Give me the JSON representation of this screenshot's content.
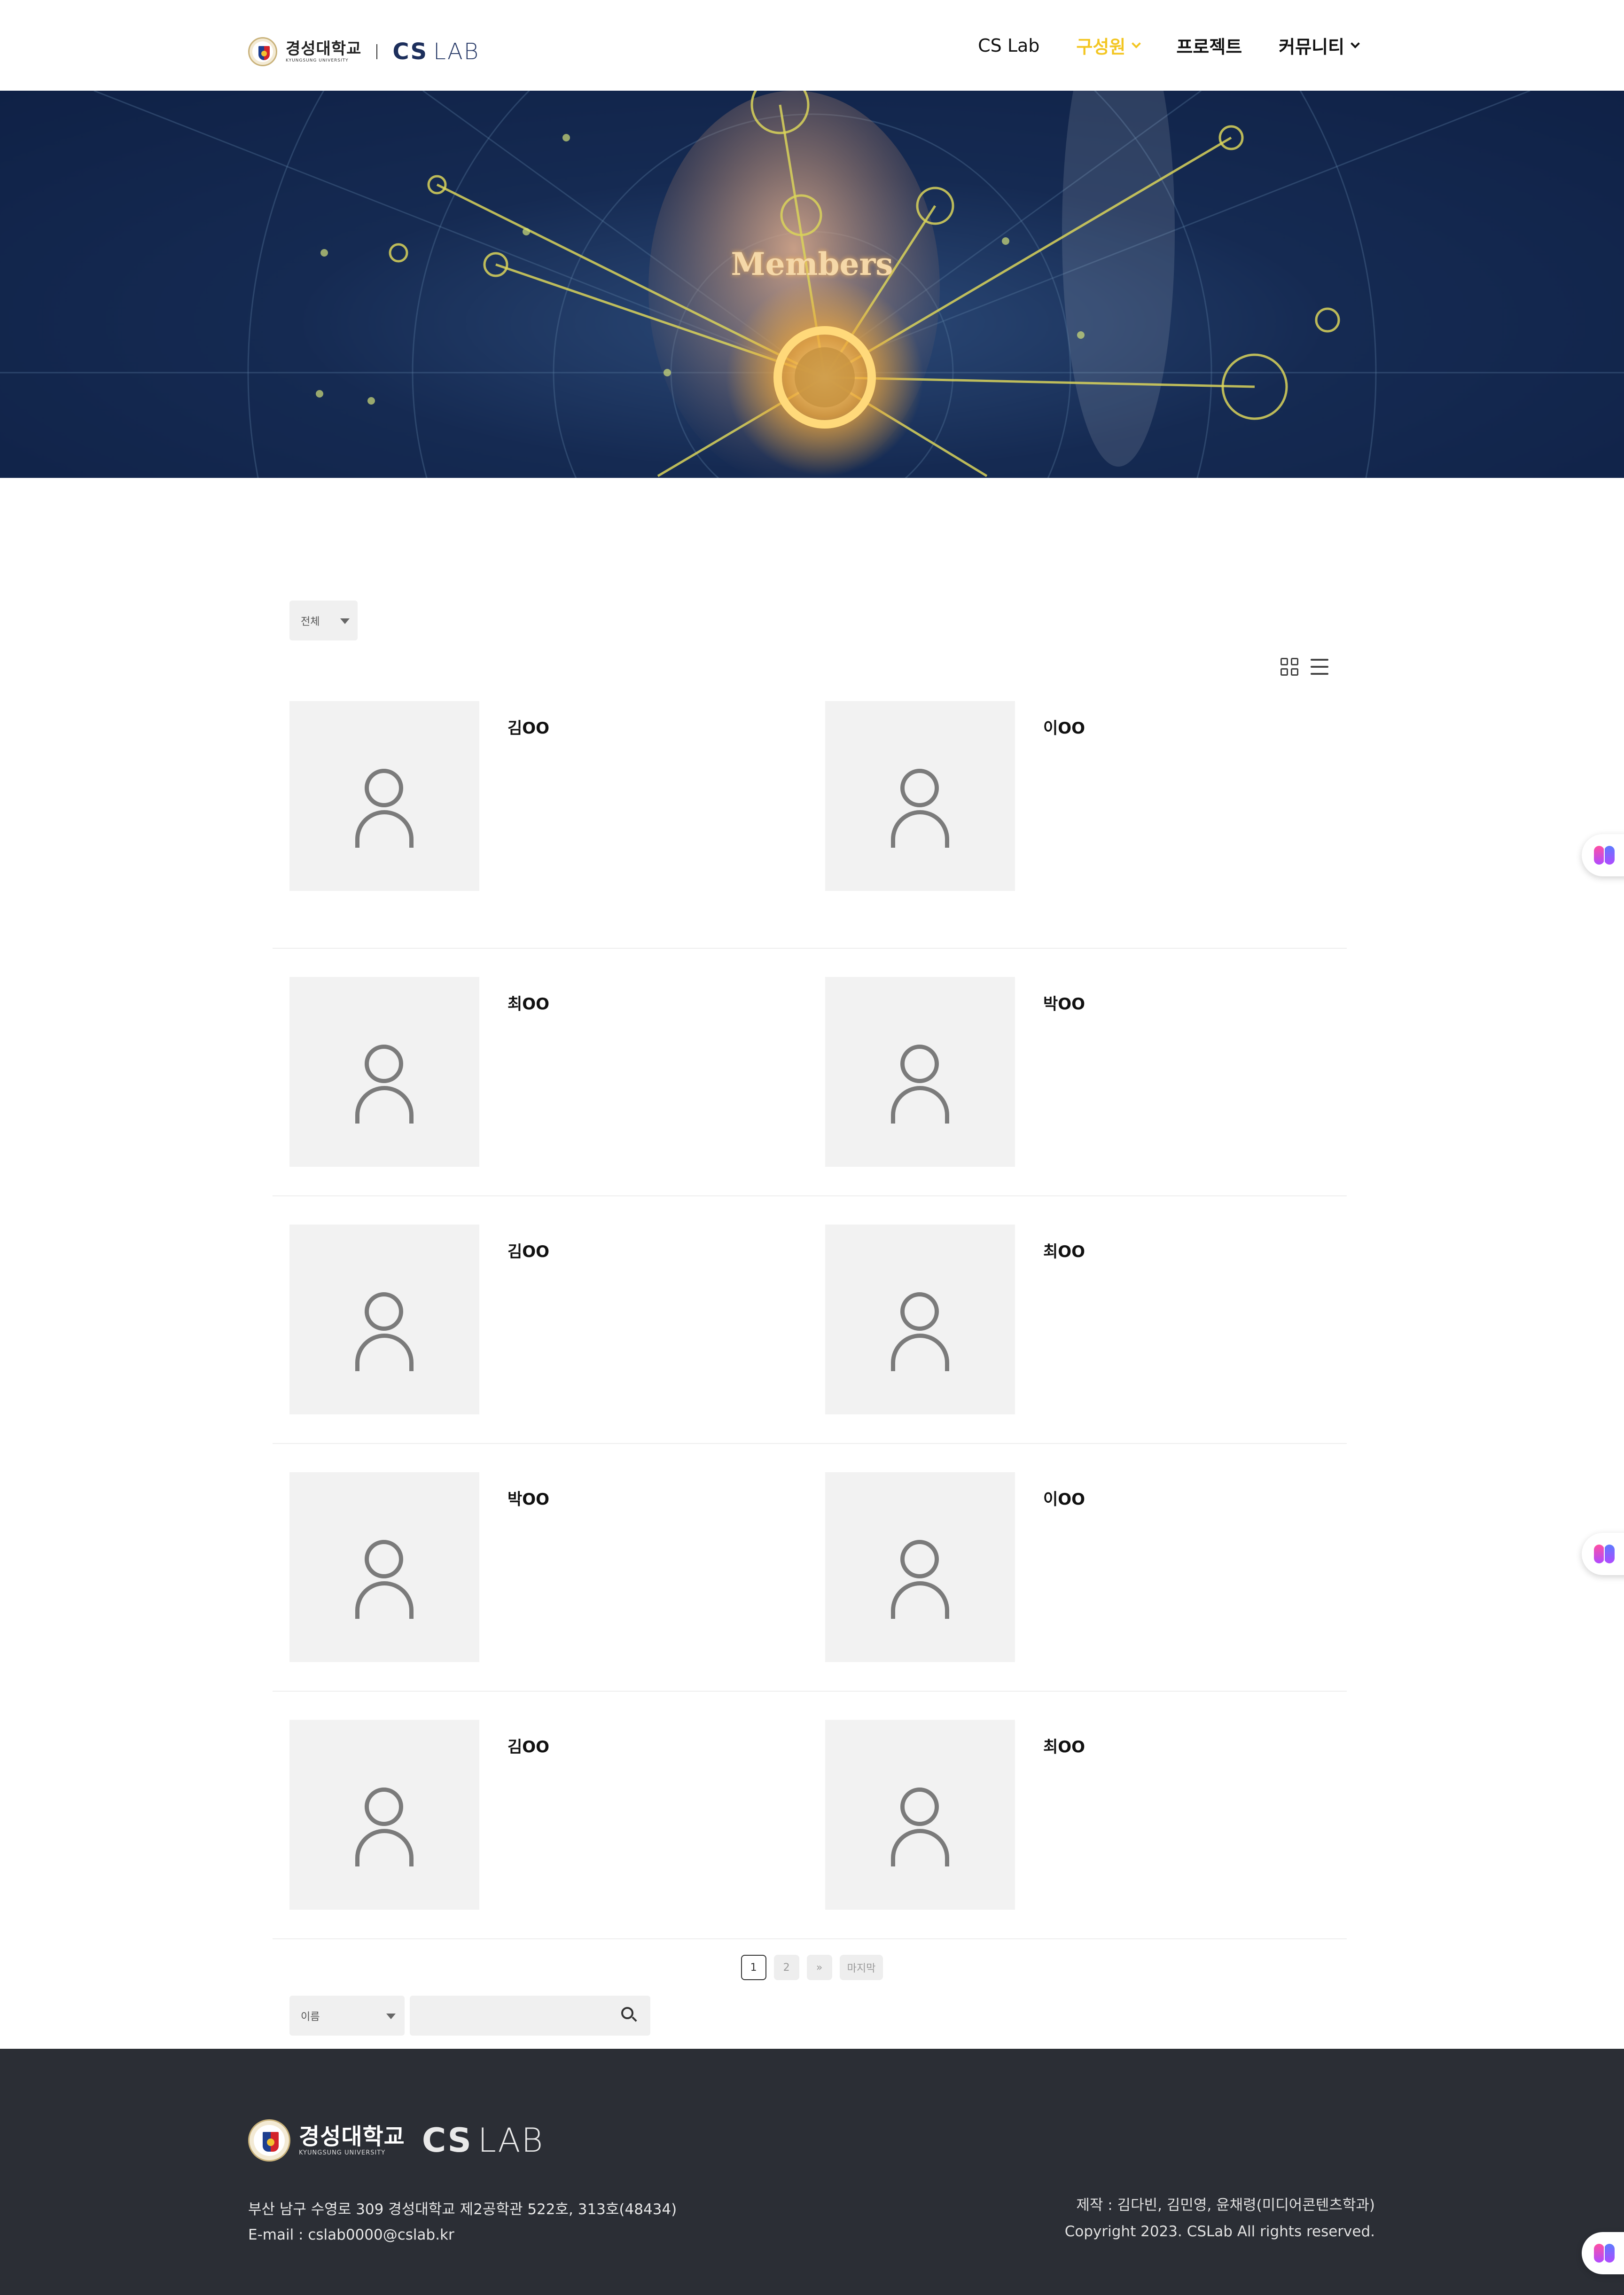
{
  "header": {
    "logo": {
      "university_ko": "경성대학교",
      "university_en": "KYUNGSUNG UNIVERSITY",
      "lab_cs": "CS",
      "lab_lab": "LAB"
    },
    "nav": [
      {
        "label": "CS Lab"
      },
      {
        "label": "구성원"
      },
      {
        "label": "프로젝트"
      },
      {
        "label": "커뮤니티"
      }
    ]
  },
  "hero": {
    "title": "Members"
  },
  "filter": {
    "selected": "전체"
  },
  "members": [
    [
      "김OO",
      "이OO"
    ],
    [
      "최OO",
      "박OO"
    ],
    [
      "김OO",
      "최OO"
    ],
    [
      "박OO",
      "이OO"
    ],
    [
      "김OO",
      "최OO"
    ]
  ],
  "pagination": {
    "pages": [
      "1",
      "2",
      "»",
      "마지막"
    ]
  },
  "search": {
    "field_selected": "이름",
    "query": ""
  },
  "footer": {
    "address": "부산 남구 수영로 309 경성대학교 제2공학관 522호, 313호(48434)",
    "email": "E-mail : cslab0000@cslab.kr",
    "credits": "제작 : 김다빈, 김민영, 윤채령(미디어콘텐츠학과)",
    "copyright": "Copyright 2023. CSLab All rights reserved."
  },
  "colors": {
    "accent_active_nav": "#f3c622",
    "footer_bg": "#2b2e35",
    "hero_bg": "#152a52"
  },
  "icons": [
    "chevron-down-icon",
    "grid-view-icon",
    "list-view-icon",
    "user-placeholder-icon",
    "search-icon",
    "brain-icon"
  ]
}
